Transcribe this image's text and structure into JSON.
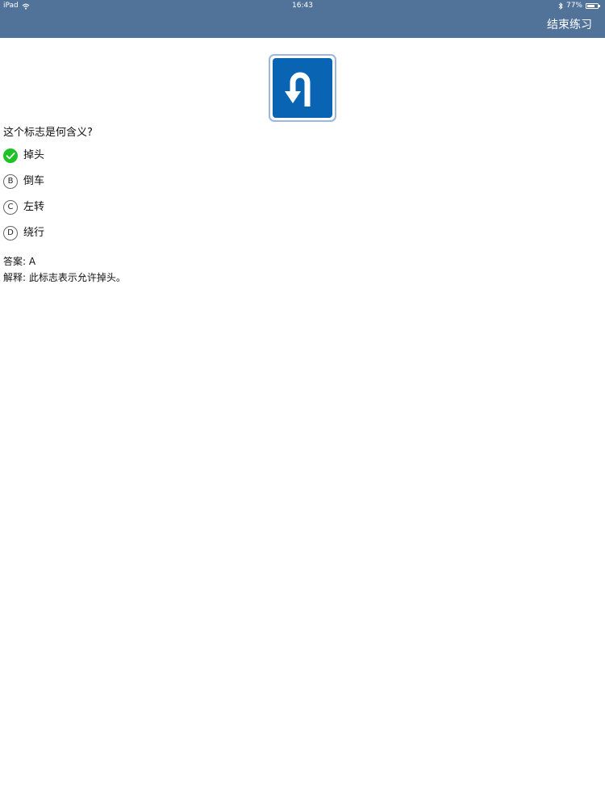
{
  "status_bar": {
    "device": "iPad",
    "time": "16:43",
    "battery": "77%",
    "battery_level": 0.77
  },
  "header": {
    "end_button_label": "结束练习"
  },
  "sign": {
    "icon": "u-turn-sign-icon",
    "color": "#0a64b4"
  },
  "question": {
    "text": "这个标志是何含义?"
  },
  "options": [
    {
      "marker": "A",
      "text": "掉头",
      "correct": true
    },
    {
      "marker": "B",
      "text": "倒车",
      "correct": false
    },
    {
      "marker": "C",
      "text": "左转",
      "correct": false
    },
    {
      "marker": "D",
      "text": "绕行",
      "correct": false
    }
  ],
  "answer": {
    "label": "答案:",
    "value": "A"
  },
  "explanation": {
    "label": "解释:",
    "text": "此标志表示允许掉头。"
  },
  "colors": {
    "header": "#51739a",
    "correct": "#1fc226"
  }
}
